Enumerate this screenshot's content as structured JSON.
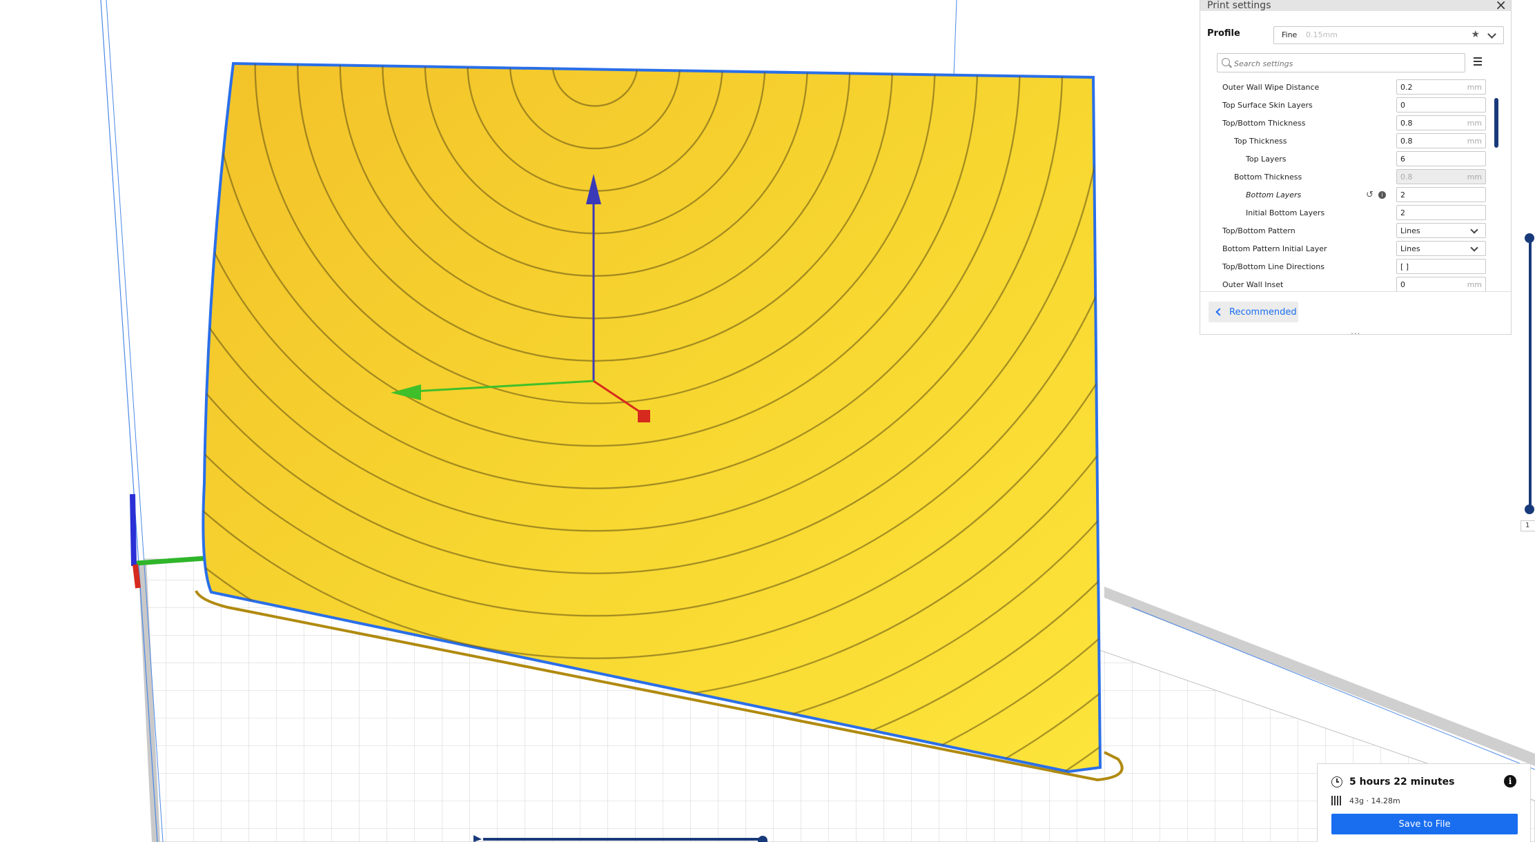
{
  "print_settings": {
    "title": "Print settings",
    "close_icon": "×",
    "profile_label": "Profile",
    "profile_name": "Fine",
    "profile_layer": "0.15mm",
    "search_placeholder": "Search settings",
    "rows": [
      {
        "label": "Outer Wall Wipe Distance",
        "value": "0.2",
        "unit": "mm",
        "indent": 0
      },
      {
        "label": "Top Surface Skin Layers",
        "value": "0",
        "unit": "",
        "indent": 0
      },
      {
        "label": "Top/Bottom Thickness",
        "value": "0.8",
        "unit": "mm",
        "indent": 0
      },
      {
        "label": "Top Thickness",
        "value": "0.8",
        "unit": "mm",
        "indent": 1
      },
      {
        "label": "Top Layers",
        "value": "6",
        "unit": "",
        "indent": 2
      },
      {
        "label": "Bottom Thickness",
        "value": "0.8",
        "unit": "mm",
        "indent": 1
      },
      {
        "label": "Bottom Layers",
        "value": "2",
        "unit": "",
        "indent": 2
      },
      {
        "label": "Initial Bottom Layers",
        "value": "2",
        "unit": "",
        "indent": 2
      },
      {
        "label": "Top/Bottom Pattern",
        "value": "Lines",
        "unit": "",
        "indent": 0
      },
      {
        "label": "Bottom Pattern Initial Layer",
        "value": "Lines",
        "unit": "",
        "indent": 0
      },
      {
        "label": "Top/Bottom Line Directions",
        "value": "[ ]",
        "unit": "",
        "indent": 0
      },
      {
        "label": "Outer Wall Inset",
        "value": "0",
        "unit": "mm",
        "indent": 0
      }
    ],
    "recommended_label": "Recommended",
    "drag_handle": "..."
  },
  "layer_slider": {
    "value": "1"
  },
  "estimate": {
    "time": "5 hours 22 minutes",
    "material": "43g · 14.28m",
    "info_icon": "i",
    "save_label": "Save to File"
  },
  "colors": {
    "model": "#f8d42a",
    "model_outline": "#2a6fe8",
    "accent": "#196ef0",
    "axis_x": "#d62a1e",
    "axis_y": "#2fb52a",
    "axis_z": "#2a2fd6"
  }
}
